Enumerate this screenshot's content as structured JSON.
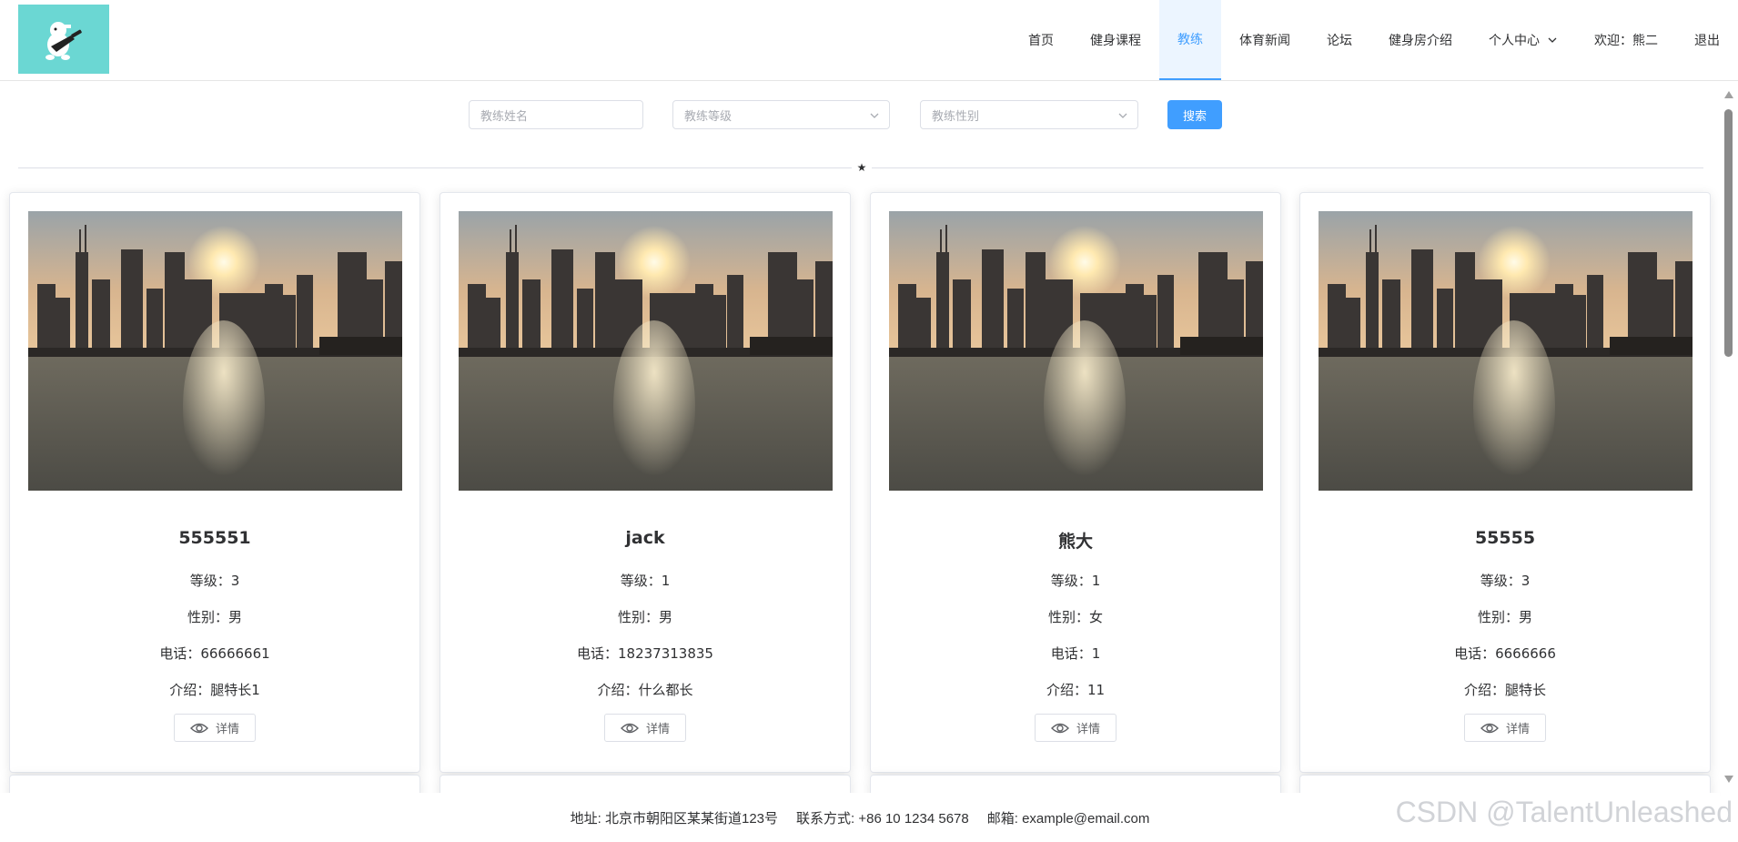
{
  "header": {
    "nav": [
      {
        "label": "首页",
        "name": "nav-home"
      },
      {
        "label": "健身课程",
        "name": "nav-courses"
      },
      {
        "label": "教练",
        "name": "nav-coaches",
        "active": true
      },
      {
        "label": "体育新闻",
        "name": "nav-sports-news"
      },
      {
        "label": "论坛",
        "name": "nav-forum"
      },
      {
        "label": "健身房介绍",
        "name": "nav-gym-intro"
      }
    ],
    "personal_center": "个人中心",
    "welcome": "欢迎：熊二",
    "logout": "退出"
  },
  "search": {
    "name_placeholder": "教练姓名",
    "level_placeholder": "教练等级",
    "gender_placeholder": "教练性别",
    "button_label": "搜索"
  },
  "divider_icon": "star-icon",
  "coaches": [
    {
      "name": "555551",
      "level": "等级：3",
      "gender": "性别：男",
      "phone": "电话：66666661",
      "intro": "介绍：腿特长1",
      "detail_label": "详情"
    },
    {
      "name": "jack",
      "level": "等级：1",
      "gender": "性别：男",
      "phone": "电话：18237313835",
      "intro": "介绍：什么都长",
      "detail_label": "详情"
    },
    {
      "name": "熊大",
      "level": "等级：1",
      "gender": "性别：女",
      "phone": "电话：1",
      "intro": "介绍：11",
      "detail_label": "详情"
    },
    {
      "name": "55555",
      "level": "等级：3",
      "gender": "性别：男",
      "phone": "电话：6666666",
      "intro": "介绍：腿特长",
      "detail_label": "详情"
    }
  ],
  "footer": {
    "address": "地址: 北京市朝阳区某某街道123号",
    "contact": "联系方式: +86 10 1234 5678",
    "email": "邮箱: example@email.com"
  },
  "watermark": "CSDN @TalentUnleashed",
  "colors": {
    "accent": "#409eff",
    "logo_bg": "#6bd7d3",
    "active_bg": "#ecf5ff"
  }
}
